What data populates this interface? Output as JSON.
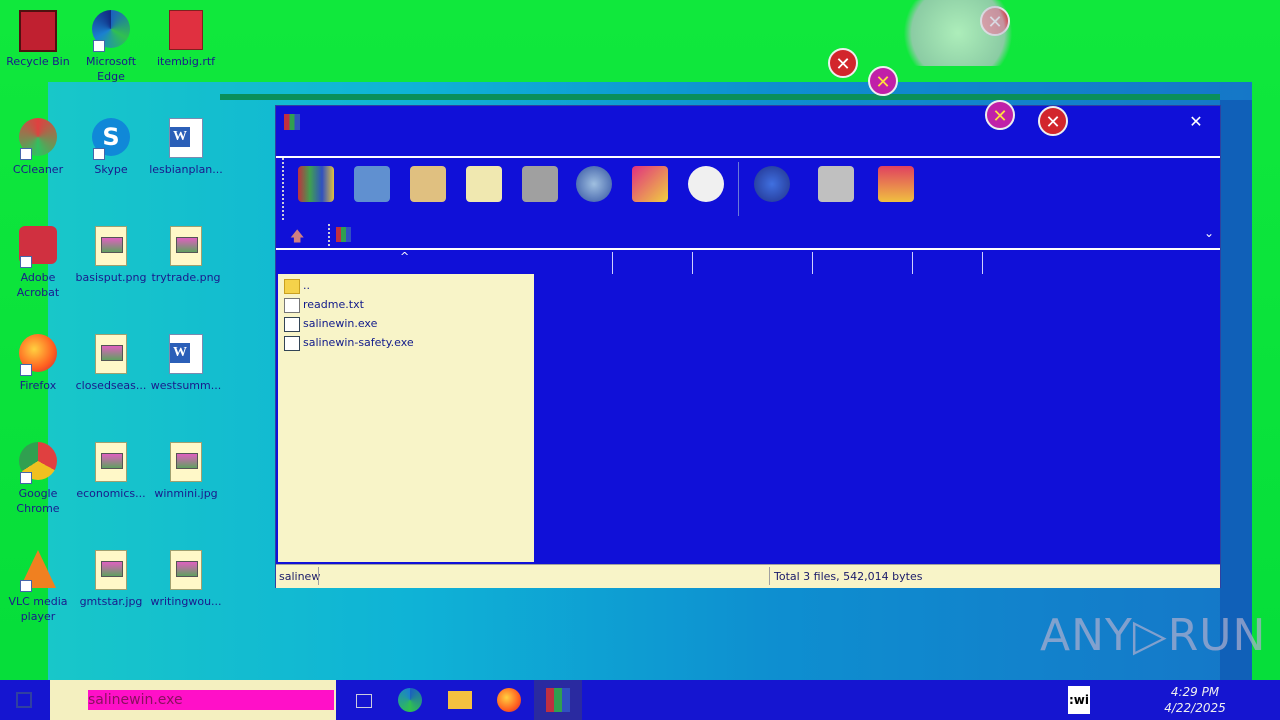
{
  "desktop": {
    "icons": [
      {
        "label": "Recycle Bin"
      },
      {
        "label": "Microsoft Edge"
      },
      {
        "label": "itembig.rtf"
      },
      {
        "label": "CCleaner"
      },
      {
        "label": "Skype"
      },
      {
        "label": "lesbianplan..."
      },
      {
        "label": "Adobe Acrobat"
      },
      {
        "label": "basisput.png"
      },
      {
        "label": "trytrade.png"
      },
      {
        "label": "Firefox"
      },
      {
        "label": "closedseas..."
      },
      {
        "label": "westsumm..."
      },
      {
        "label": "Google Chrome"
      },
      {
        "label": "economics..."
      },
      {
        "label": "winmini.jpg"
      },
      {
        "label": "VLC media player"
      },
      {
        "label": "gmtstar.jpg"
      },
      {
        "label": "writingwou..."
      }
    ]
  },
  "window": {
    "close_glyph": "✕",
    "tree_items": [
      {
        "label": "..",
        "icon": "folder-icon"
      },
      {
        "label": "readme.txt",
        "icon": "text-file-icon"
      },
      {
        "label": "salinewin.exe",
        "icon": "exe-file-icon"
      },
      {
        "label": "salinewin-safety.exe",
        "icon": "exe-file-icon"
      }
    ],
    "status_left": "salinew",
    "status_right": "Total 3 files, 542,014 bytes"
  },
  "taskbar": {
    "search_text": "salinewin.exe",
    "tray_text": ":wi",
    "time": "4:29 PM",
    "date": "4/22/2025"
  },
  "watermark": "ANY▷RUN"
}
